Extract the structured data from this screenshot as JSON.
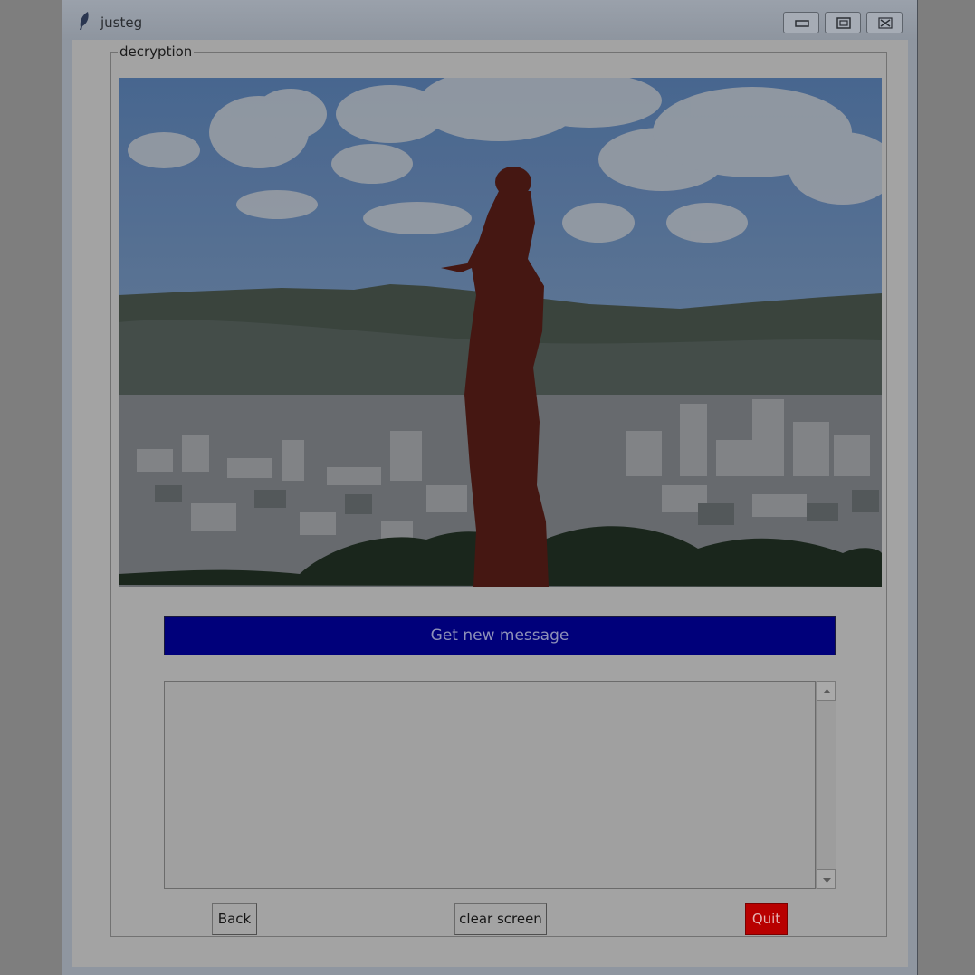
{
  "window": {
    "title": "justeg"
  },
  "group": {
    "label": "decryption"
  },
  "main": {
    "image_icon": "photo-image",
    "get_button_label": "Get new message",
    "message_text": ""
  },
  "buttons": {
    "back": "Back",
    "clear": "clear screen",
    "quit": "Quit"
  },
  "colors": {
    "get_button_bg": "#00007a",
    "quit_bg": "#b80000"
  }
}
